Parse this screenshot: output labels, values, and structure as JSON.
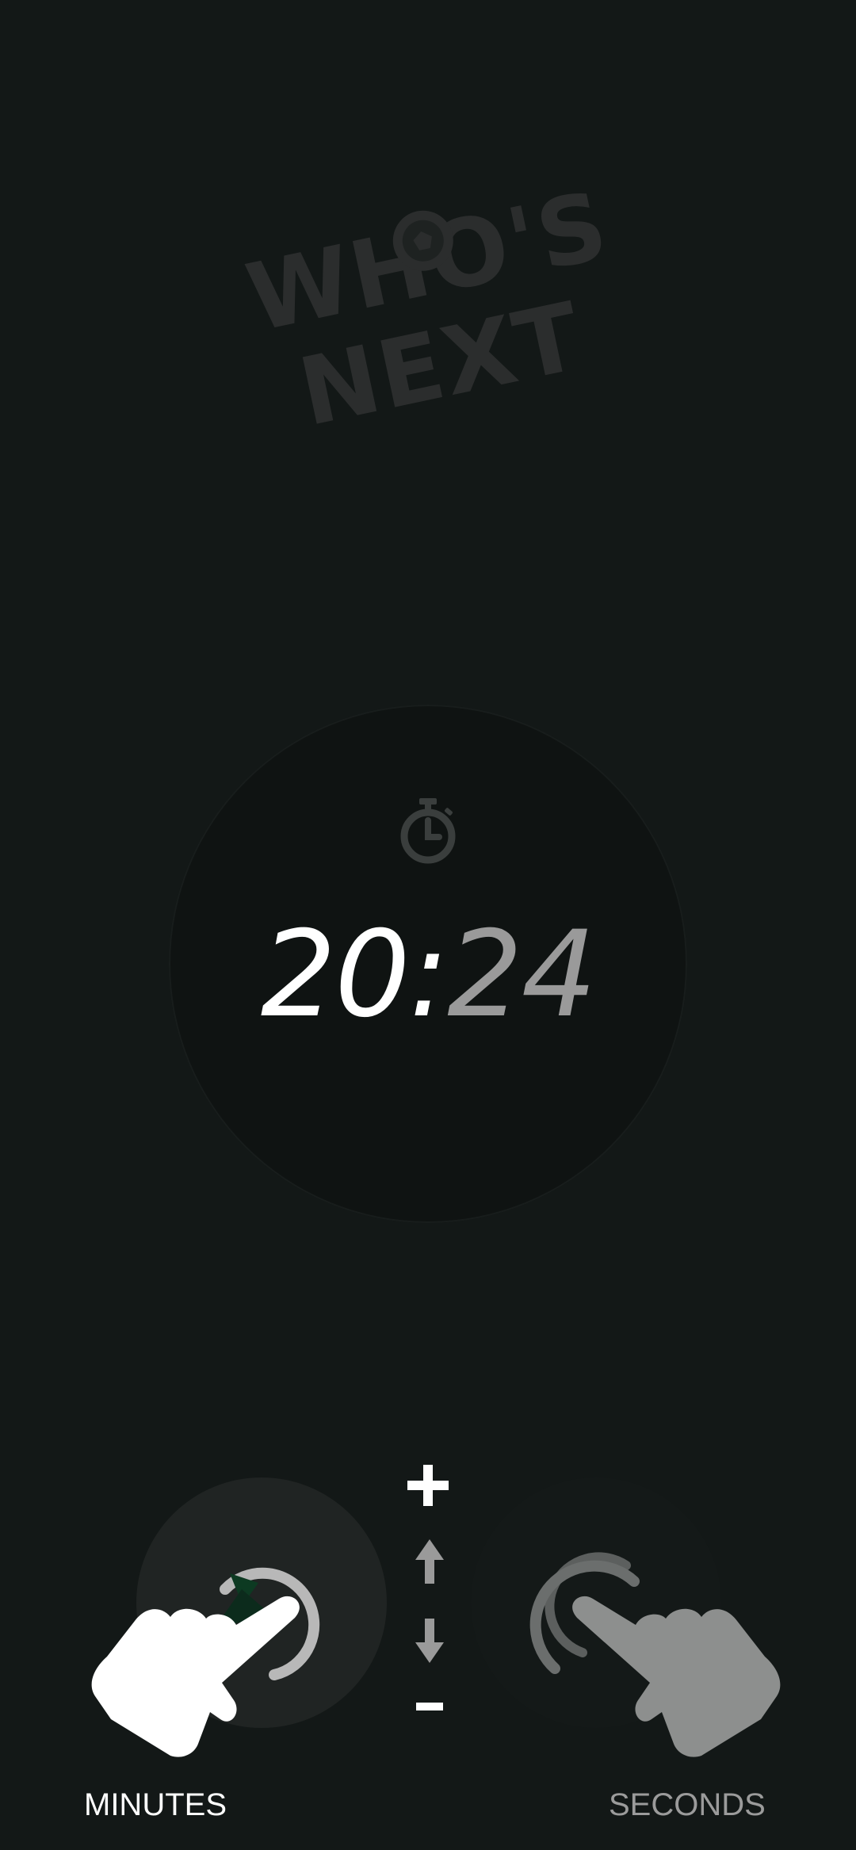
{
  "app": {
    "logo_line1": "WHO'S",
    "logo_line2": "NEXT"
  },
  "timer": {
    "minutes": "20",
    "separator": ":",
    "seconds": "24"
  },
  "controls": {
    "increase_symbol": "+",
    "decrease_symbol": "-",
    "minutes_label": "MINUTES",
    "seconds_label": "SECONDS",
    "active_mode": "minutes"
  },
  "icons": {
    "logo": "whos-next-logo",
    "stopwatch": "stopwatch-icon",
    "up_arrow": "arrow-up-icon",
    "down_arrow": "arrow-down-icon",
    "hand": "swipe-hand-icon",
    "rotate": "rotate-icon"
  },
  "colors": {
    "background": "#131817",
    "dial": "#0f1312",
    "active": "#ffffff",
    "inactive": "#9a9a9a",
    "accent_green": "#0d3a22"
  }
}
